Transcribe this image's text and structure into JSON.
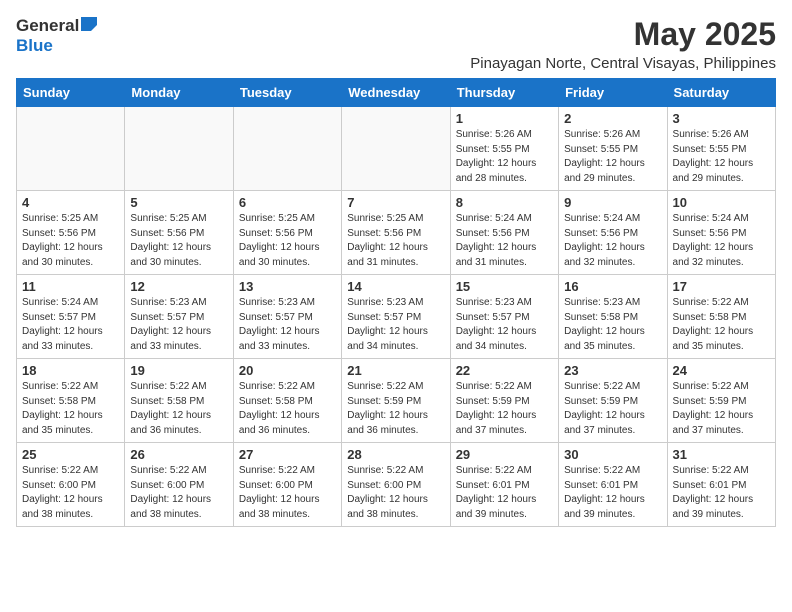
{
  "logo": {
    "general": "General",
    "blue": "Blue"
  },
  "title": "May 2025",
  "subtitle": "Pinayagan Norte, Central Visayas, Philippines",
  "headers": [
    "Sunday",
    "Monday",
    "Tuesday",
    "Wednesday",
    "Thursday",
    "Friday",
    "Saturday"
  ],
  "weeks": [
    [
      {
        "day": "",
        "info": ""
      },
      {
        "day": "",
        "info": ""
      },
      {
        "day": "",
        "info": ""
      },
      {
        "day": "",
        "info": ""
      },
      {
        "day": "1",
        "info": "Sunrise: 5:26 AM\nSunset: 5:55 PM\nDaylight: 12 hours\nand 28 minutes."
      },
      {
        "day": "2",
        "info": "Sunrise: 5:26 AM\nSunset: 5:55 PM\nDaylight: 12 hours\nand 29 minutes."
      },
      {
        "day": "3",
        "info": "Sunrise: 5:26 AM\nSunset: 5:55 PM\nDaylight: 12 hours\nand 29 minutes."
      }
    ],
    [
      {
        "day": "4",
        "info": "Sunrise: 5:25 AM\nSunset: 5:56 PM\nDaylight: 12 hours\nand 30 minutes."
      },
      {
        "day": "5",
        "info": "Sunrise: 5:25 AM\nSunset: 5:56 PM\nDaylight: 12 hours\nand 30 minutes."
      },
      {
        "day": "6",
        "info": "Sunrise: 5:25 AM\nSunset: 5:56 PM\nDaylight: 12 hours\nand 30 minutes."
      },
      {
        "day": "7",
        "info": "Sunrise: 5:25 AM\nSunset: 5:56 PM\nDaylight: 12 hours\nand 31 minutes."
      },
      {
        "day": "8",
        "info": "Sunrise: 5:24 AM\nSunset: 5:56 PM\nDaylight: 12 hours\nand 31 minutes."
      },
      {
        "day": "9",
        "info": "Sunrise: 5:24 AM\nSunset: 5:56 PM\nDaylight: 12 hours\nand 32 minutes."
      },
      {
        "day": "10",
        "info": "Sunrise: 5:24 AM\nSunset: 5:56 PM\nDaylight: 12 hours\nand 32 minutes."
      }
    ],
    [
      {
        "day": "11",
        "info": "Sunrise: 5:24 AM\nSunset: 5:57 PM\nDaylight: 12 hours\nand 33 minutes."
      },
      {
        "day": "12",
        "info": "Sunrise: 5:23 AM\nSunset: 5:57 PM\nDaylight: 12 hours\nand 33 minutes."
      },
      {
        "day": "13",
        "info": "Sunrise: 5:23 AM\nSunset: 5:57 PM\nDaylight: 12 hours\nand 33 minutes."
      },
      {
        "day": "14",
        "info": "Sunrise: 5:23 AM\nSunset: 5:57 PM\nDaylight: 12 hours\nand 34 minutes."
      },
      {
        "day": "15",
        "info": "Sunrise: 5:23 AM\nSunset: 5:57 PM\nDaylight: 12 hours\nand 34 minutes."
      },
      {
        "day": "16",
        "info": "Sunrise: 5:23 AM\nSunset: 5:58 PM\nDaylight: 12 hours\nand 35 minutes."
      },
      {
        "day": "17",
        "info": "Sunrise: 5:22 AM\nSunset: 5:58 PM\nDaylight: 12 hours\nand 35 minutes."
      }
    ],
    [
      {
        "day": "18",
        "info": "Sunrise: 5:22 AM\nSunset: 5:58 PM\nDaylight: 12 hours\nand 35 minutes."
      },
      {
        "day": "19",
        "info": "Sunrise: 5:22 AM\nSunset: 5:58 PM\nDaylight: 12 hours\nand 36 minutes."
      },
      {
        "day": "20",
        "info": "Sunrise: 5:22 AM\nSunset: 5:58 PM\nDaylight: 12 hours\nand 36 minutes."
      },
      {
        "day": "21",
        "info": "Sunrise: 5:22 AM\nSunset: 5:59 PM\nDaylight: 12 hours\nand 36 minutes."
      },
      {
        "day": "22",
        "info": "Sunrise: 5:22 AM\nSunset: 5:59 PM\nDaylight: 12 hours\nand 37 minutes."
      },
      {
        "day": "23",
        "info": "Sunrise: 5:22 AM\nSunset: 5:59 PM\nDaylight: 12 hours\nand 37 minutes."
      },
      {
        "day": "24",
        "info": "Sunrise: 5:22 AM\nSunset: 5:59 PM\nDaylight: 12 hours\nand 37 minutes."
      }
    ],
    [
      {
        "day": "25",
        "info": "Sunrise: 5:22 AM\nSunset: 6:00 PM\nDaylight: 12 hours\nand 38 minutes."
      },
      {
        "day": "26",
        "info": "Sunrise: 5:22 AM\nSunset: 6:00 PM\nDaylight: 12 hours\nand 38 minutes."
      },
      {
        "day": "27",
        "info": "Sunrise: 5:22 AM\nSunset: 6:00 PM\nDaylight: 12 hours\nand 38 minutes."
      },
      {
        "day": "28",
        "info": "Sunrise: 5:22 AM\nSunset: 6:00 PM\nDaylight: 12 hours\nand 38 minutes."
      },
      {
        "day": "29",
        "info": "Sunrise: 5:22 AM\nSunset: 6:01 PM\nDaylight: 12 hours\nand 39 minutes."
      },
      {
        "day": "30",
        "info": "Sunrise: 5:22 AM\nSunset: 6:01 PM\nDaylight: 12 hours\nand 39 minutes."
      },
      {
        "day": "31",
        "info": "Sunrise: 5:22 AM\nSunset: 6:01 PM\nDaylight: 12 hours\nand 39 minutes."
      }
    ]
  ]
}
